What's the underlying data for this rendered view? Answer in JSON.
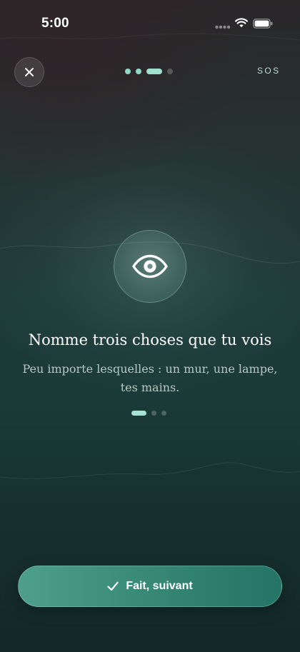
{
  "status_bar": {
    "time": "5:00"
  },
  "header": {
    "close_icon": "close-icon",
    "steps_total": 4,
    "steps_done": 2,
    "step_current": 3,
    "sos_label": "SOS"
  },
  "exercise": {
    "icon": "eye-icon",
    "title": "Nomme trois choses que tu vois",
    "subtitle_line1": "Peu importe lesquelles : un mur, une lampe,",
    "subtitle_line2": "tes mains.",
    "items_total": 3,
    "item_current": 1
  },
  "footer": {
    "check_icon": "checkmark-icon",
    "next_label": "Fait, suivant"
  },
  "colors": {
    "accent": "#9fe0cf",
    "button": "#3a8a78",
    "background": "#1a3a37"
  }
}
